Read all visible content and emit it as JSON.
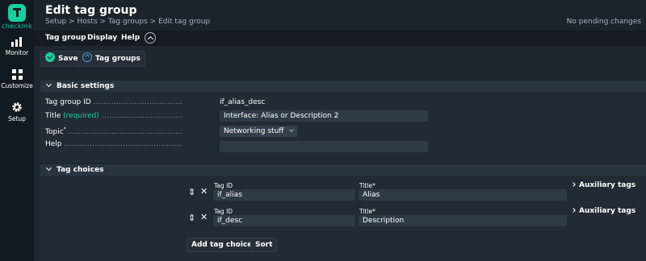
{
  "brand": {
    "logo_text": "checkmk",
    "accent": "#15d1a0"
  },
  "sidebar": {
    "items": [
      {
        "label": "Monitor",
        "icon": "bar-chart-icon"
      },
      {
        "label": "Customize",
        "icon": "grid-icon"
      },
      {
        "label": "Setup",
        "icon": "gear-icon"
      }
    ]
  },
  "header": {
    "title": "Edit tag group",
    "breadcrumb": "Setup > Hosts > Tag groups > Edit tag group",
    "pending": "No pending changes"
  },
  "menu": {
    "items": [
      "Tag group",
      "Display",
      "Help"
    ]
  },
  "toolbar": {
    "save_label": "Save",
    "tag_groups_label": "Tag groups"
  },
  "basic_settings": {
    "title": "Basic settings",
    "fields": {
      "tag_group_id": {
        "label": "Tag group ID",
        "value": "if_alias_desc"
      },
      "title": {
        "label": "Title",
        "required": "(required)",
        "value": "Interface: Alias or Description 2"
      },
      "topic": {
        "label": "Topic",
        "marker": "*",
        "value": "Networking stuff"
      },
      "help": {
        "label": "Help",
        "value": ""
      }
    }
  },
  "tag_choices": {
    "title": "Tag choices",
    "tag_id_label": "Tag ID",
    "title_label": "Title*",
    "aux_label": "Auxiliary tags",
    "rows": [
      {
        "tag_id": "if_alias",
        "title": "Alias"
      },
      {
        "tag_id": "if_desc",
        "title": "Description"
      }
    ],
    "add_label": "Add tag choice",
    "sort_label": "Sort"
  }
}
